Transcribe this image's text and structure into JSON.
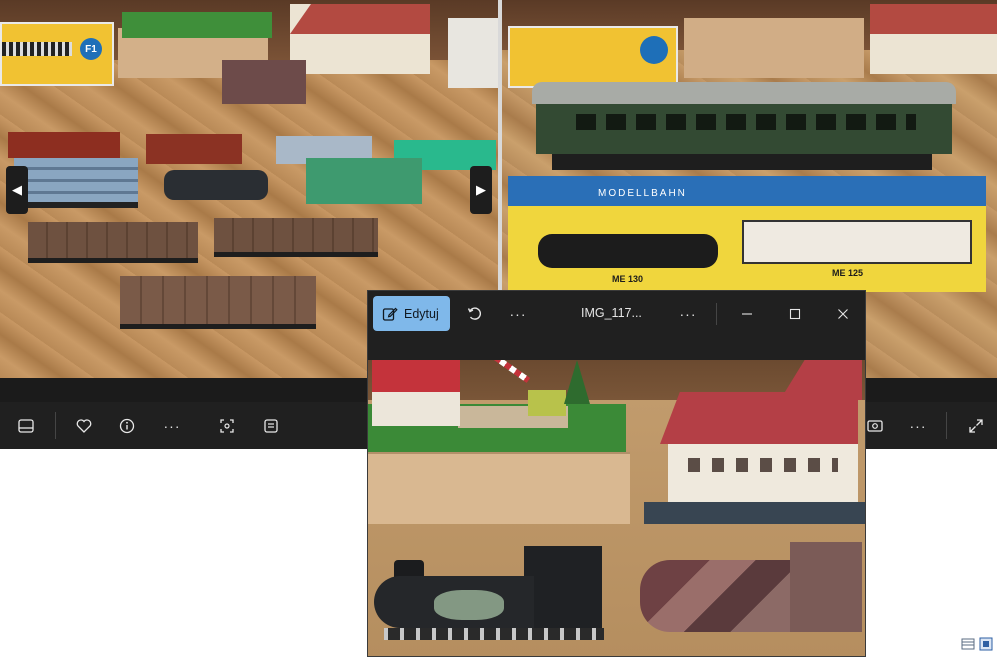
{
  "background_viewer": {
    "left_photo_label": "F1",
    "right_photo_box_labels": [
      "MODELLBAHN",
      "ME 130",
      "ME 125"
    ],
    "toolbar_icons": [
      "filmstrip-icon",
      "heart-icon",
      "info-icon",
      "more-icon",
      "fit-icon",
      "text-select-icon"
    ],
    "right_toolbar_icons": [
      "more-icon",
      "expand-icon"
    ],
    "nav_prev": "◀",
    "nav_next": "▶",
    "more_glyph": "···"
  },
  "photos_window": {
    "edit_label": "Edytuj",
    "title": "IMG_117...",
    "more_glyph": "···",
    "controls": [
      "minimize",
      "maximize",
      "close"
    ]
  },
  "colors": {
    "accent": "#7fb8ea",
    "chrome": "#202020",
    "edit_text": "#101820"
  }
}
